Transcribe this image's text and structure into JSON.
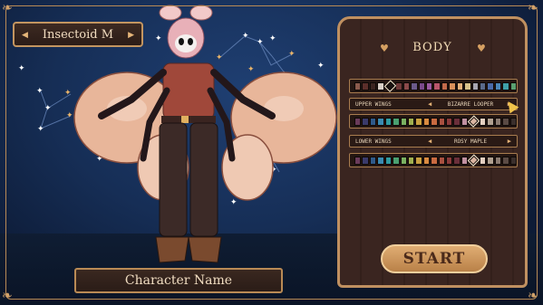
{
  "character_preset": {
    "value": "Insectoid M",
    "prev_symbol": "◀",
    "next_symbol": "▶"
  },
  "character_name_field": {
    "placeholder": "Character Name"
  },
  "body_panel": {
    "title": "BODY",
    "options": [
      {
        "label": "UPPER WINGS",
        "value": "BIZARRE LOOPER"
      },
      {
        "label": "LOWER WINGS",
        "value": "ROSY MAPLE"
      }
    ],
    "palettes": [
      {
        "colors": [
          "#8a5a4c",
          "#5b2e2a",
          "#3a2420",
          "#d9d0c8",
          "#1a1312",
          "#6f3a3a",
          "#8b4a4a",
          "#6b5a8a",
          "#7a4a8a",
          "#9a5aa0",
          "#b8556a",
          "#c26a4a",
          "#d9905a",
          "#e4b07a",
          "#d7c18a",
          "#a7a5b0",
          "#5a6a8a",
          "#4a6aa8",
          "#4a86b8",
          "#3fa0a8",
          "#5aa070"
        ],
        "selected": 4
      },
      {
        "colors": [
          "#6a3b5a",
          "#3a3a6a",
          "#2f5a8a",
          "#3a8ab0",
          "#2f9aa0",
          "#4aa070",
          "#7ab060",
          "#a0b050",
          "#c9a040",
          "#d98a40",
          "#c96a40",
          "#a85040",
          "#8a3a3a",
          "#6a2f3a",
          "#c090a0",
          "#d9b4a0",
          "#e4cfc0",
          "#b0a090",
          "#8a7a70",
          "#5a4a44",
          "#3a2f2c"
        ],
        "selected": 15
      },
      {
        "colors": [
          "#6a3b5a",
          "#3a3a6a",
          "#2f5a8a",
          "#3a8ab0",
          "#2f9aa0",
          "#4aa070",
          "#7ab060",
          "#a0b050",
          "#c9a040",
          "#d98a40",
          "#c96a40",
          "#a85040",
          "#8a3a3a",
          "#6a2f3a",
          "#c090a0",
          "#d9b4a0",
          "#e4cfc0",
          "#b0a090",
          "#8a7a70",
          "#5a4a44",
          "#3a2f2c"
        ],
        "selected": 15
      }
    ]
  },
  "start_button": {
    "label": "START"
  },
  "colors": {
    "panel_border": "#c09060",
    "text_light": "#f2ddc0",
    "accent_gold": "#e0ad73"
  }
}
